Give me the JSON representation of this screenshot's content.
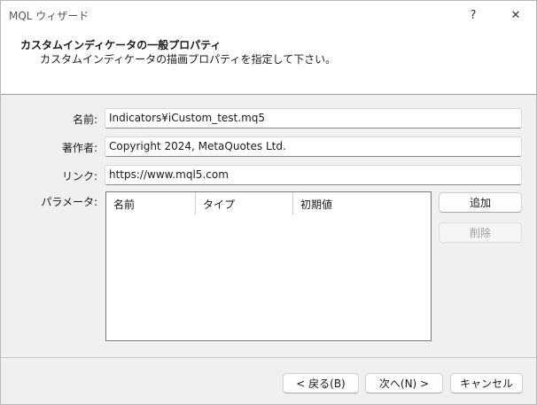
{
  "window": {
    "title": "MQL ウィザード"
  },
  "titlebar": {
    "help_label": "?",
    "close_label": "✕"
  },
  "header": {
    "title": "カスタムインディケータの一般プロパティ",
    "subtitle": "カスタムインディケータの描画プロパティを指定して下さい。"
  },
  "form": {
    "name_label": "名前:",
    "name_value": "Indicators¥iCustom_test.mq5",
    "author_label": "著作者:",
    "author_value": "Copyright 2024, MetaQuotes Ltd.",
    "link_label": "リンク:",
    "link_value": "https://www.mql5.com",
    "params_label": "パラメータ:"
  },
  "params_table": {
    "columns": [
      "名前",
      "タイプ",
      "初期値"
    ],
    "rows": []
  },
  "params_buttons": {
    "add": "追加",
    "delete": "削除"
  },
  "footer": {
    "back": "< 戻る(B)",
    "next": "次へ(N) >",
    "cancel": "キャンセル"
  }
}
